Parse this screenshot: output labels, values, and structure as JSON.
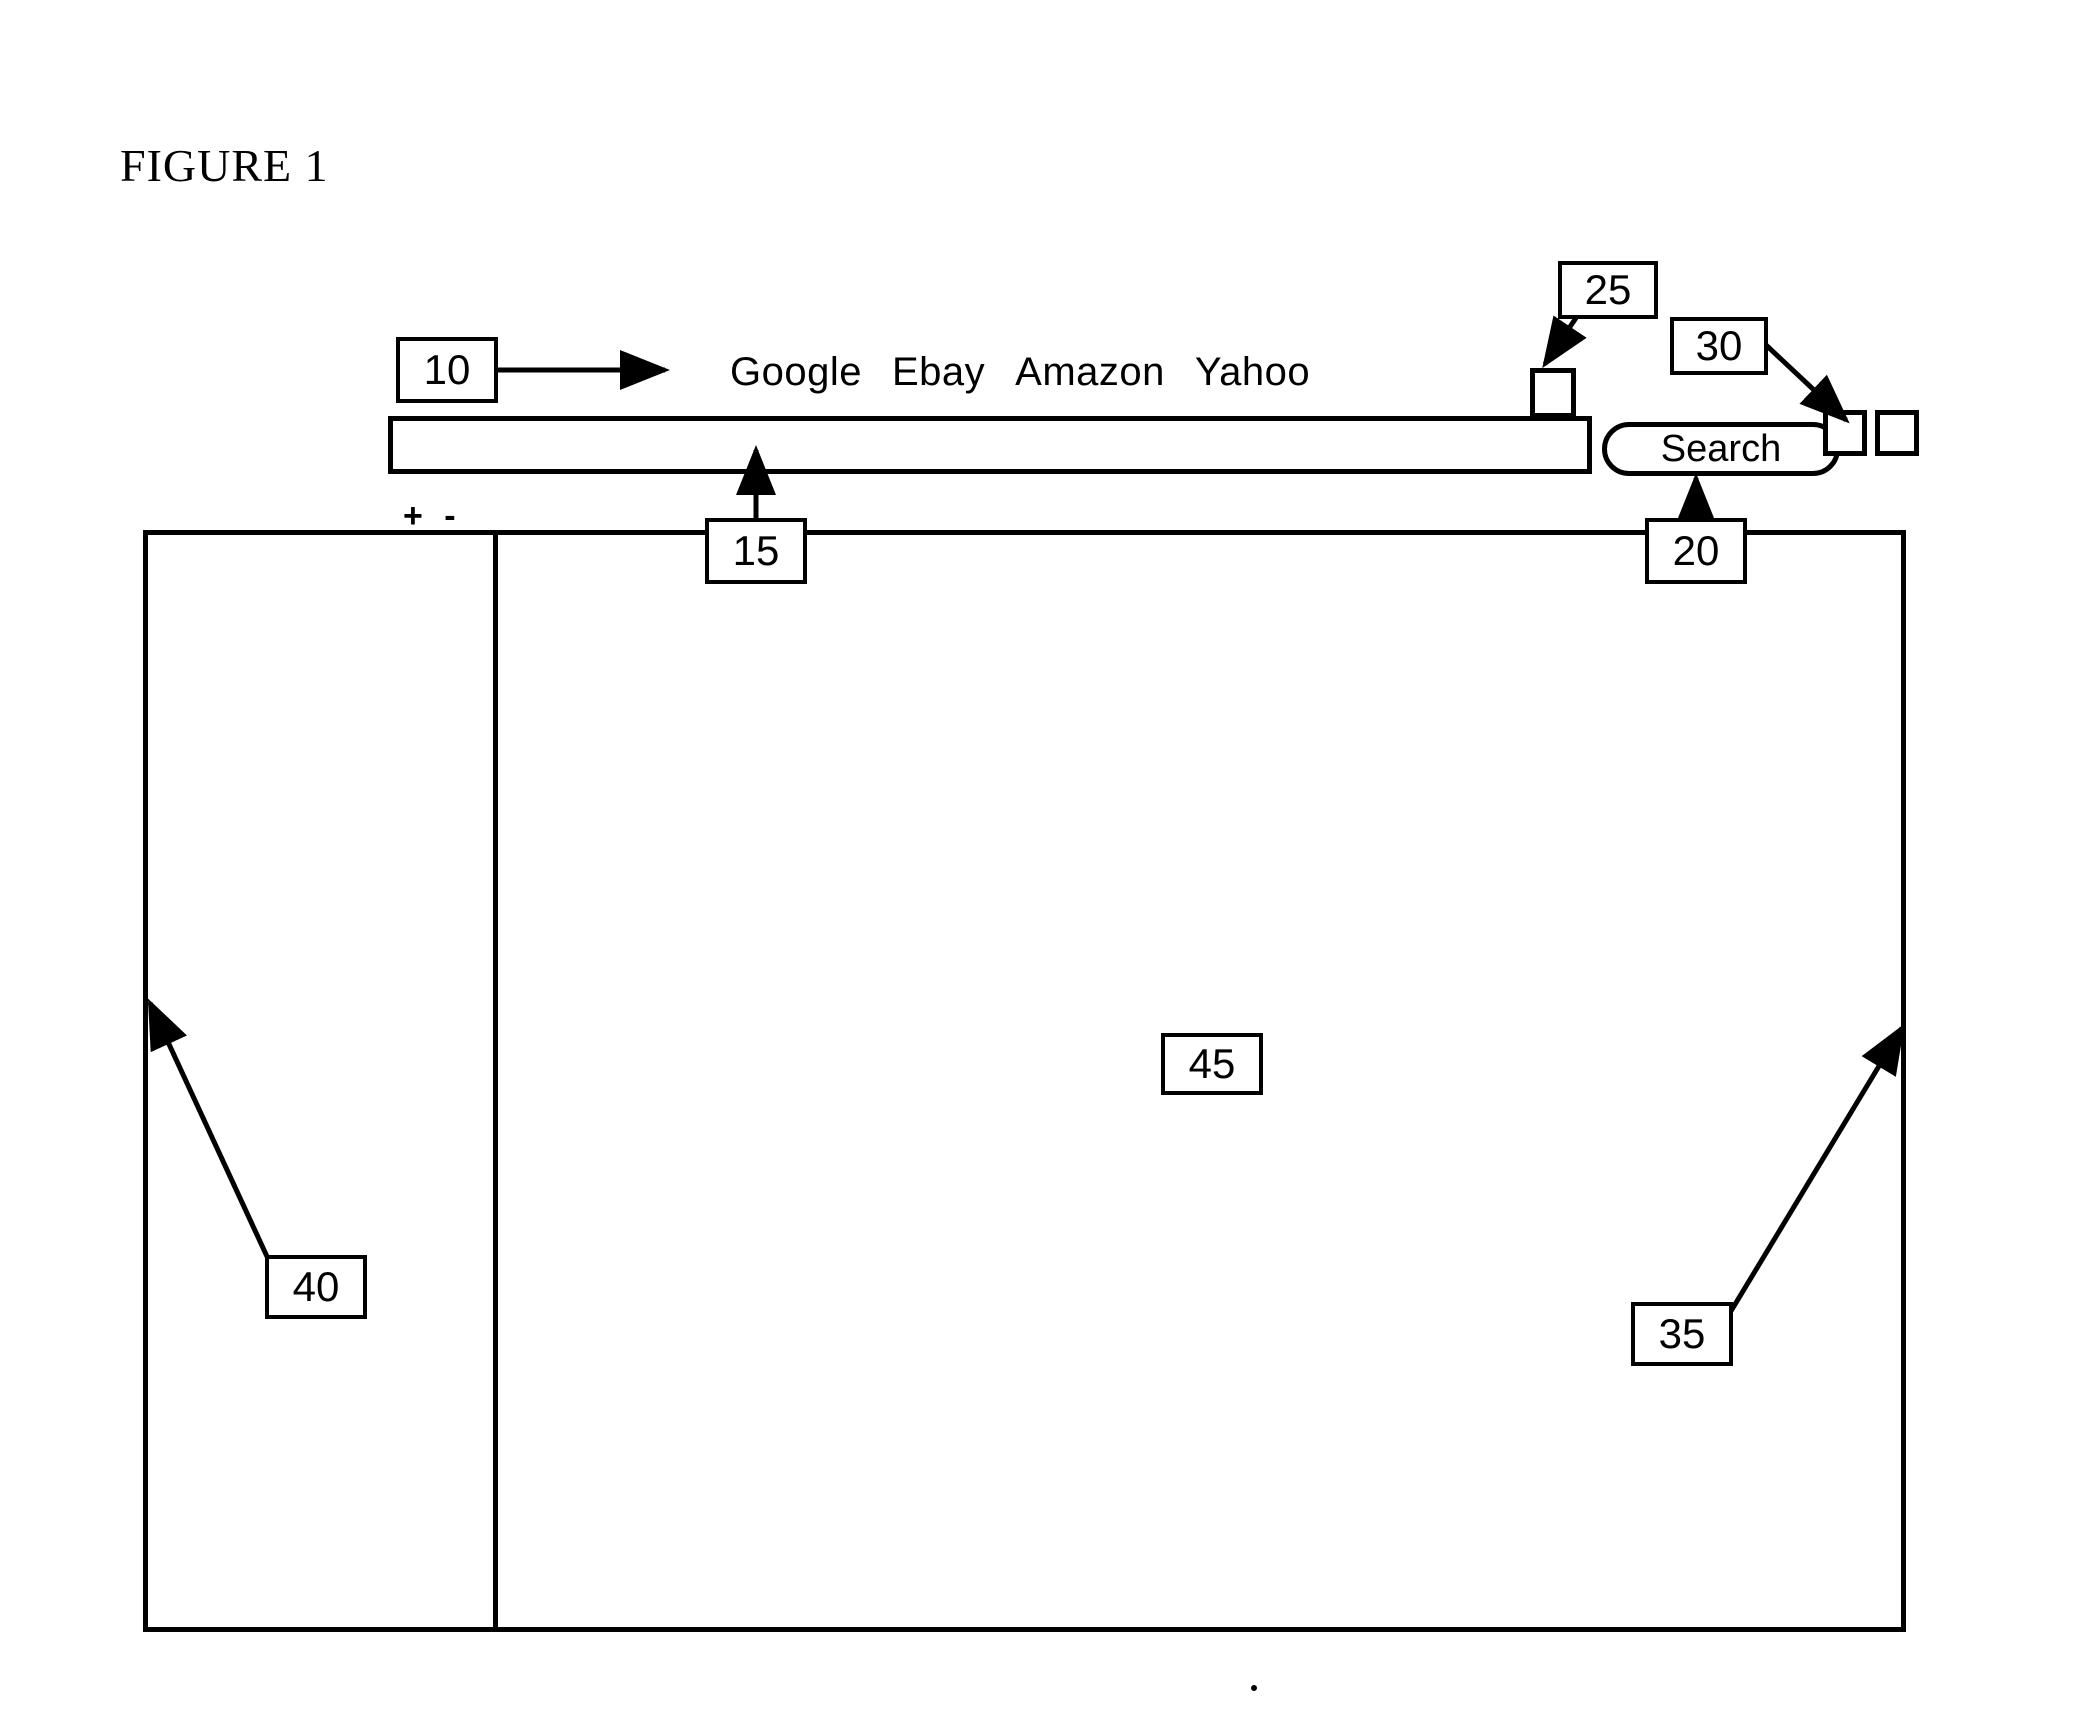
{
  "figure": {
    "title": "FIGURE 1"
  },
  "browser": {
    "nav_links": [
      {
        "label": "Google"
      },
      {
        "label": "Ebay"
      },
      {
        "label": "Amazon"
      },
      {
        "label": "Yahoo"
      }
    ],
    "url_bar": {
      "value": "",
      "placeholder": ""
    },
    "search_button": {
      "label": "Search"
    },
    "zoom_controls": {
      "label": "+ -",
      "zoom_in": "+",
      "zoom_out": "-"
    },
    "toolbar_icons": [
      {
        "name": "toolbar-icon-25"
      },
      {
        "name": "toolbar-icon-30-a"
      },
      {
        "name": "toolbar-icon-30-b"
      }
    ]
  },
  "callouts": {
    "nav_links_ref": "10",
    "url_bar_ref": "15",
    "search_button_ref": "20",
    "toolbar_icon_ref": "25",
    "extension_icons_ref": "30",
    "right_border_ref": "35",
    "left_panel_ref": "40",
    "content_area_ref": "45"
  },
  "colors": {
    "ink": "#000000",
    "page": "#ffffff"
  }
}
